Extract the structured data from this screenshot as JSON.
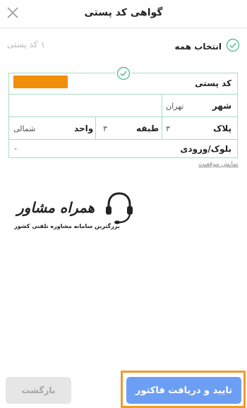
{
  "header": {
    "title": "گواهی کد پستی"
  },
  "selection": {
    "select_all_label": "انتخاب همه",
    "count_number": "۱",
    "count_label": "کد پستی"
  },
  "card": {
    "postal_code_label": "کد پستی",
    "city_label": "شهر",
    "city_value": "تهران",
    "plaque_label": "پلاک",
    "plaque_value": "۳",
    "floor_label": "طبقه",
    "floor_value": "۳",
    "unit_label": "واحد",
    "unit_value": "شمالی",
    "block_label": "بلوک/ورودی",
    "block_value": "-"
  },
  "map_link": "نمایش موقعیت",
  "watermark": {
    "brand": "همراه مشاور",
    "tagline": "بزرگترین سامانه مشاوره تلفنی کشور"
  },
  "buttons": {
    "back": "بازگشت",
    "confirm": "تایید و دریافت فاکتور"
  },
  "colors": {
    "accent": "#6c9ff4",
    "highlight": "#ef9a2a",
    "border": "#a9dbc9",
    "redact": "#f38e0b"
  },
  "icons": {
    "close": "close-icon",
    "check": "check-circle-icon"
  }
}
